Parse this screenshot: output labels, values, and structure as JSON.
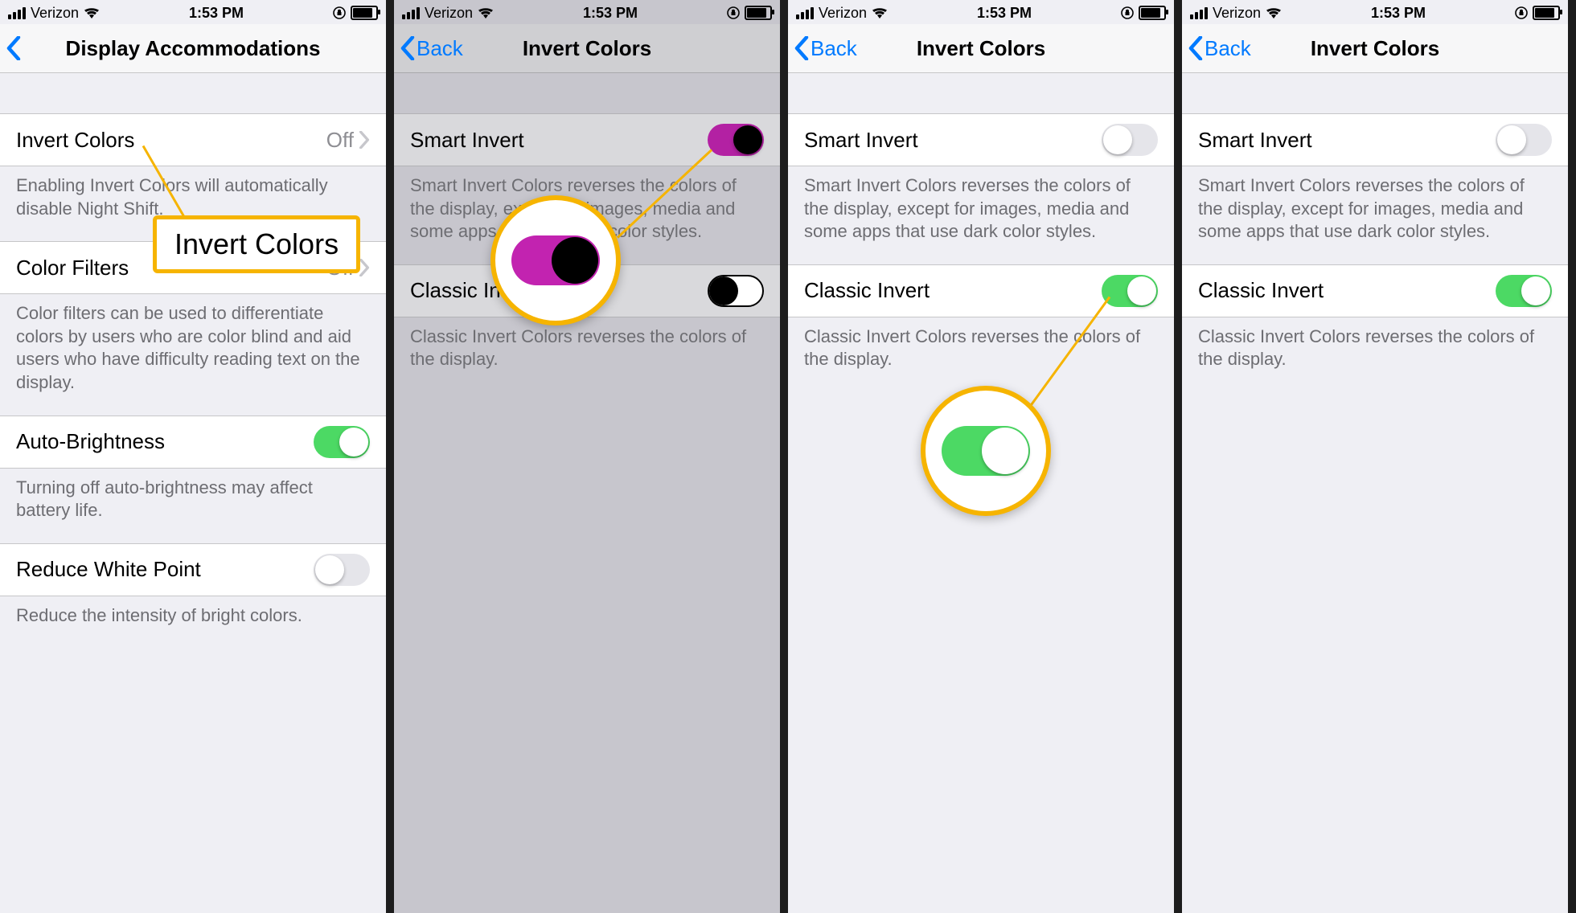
{
  "status": {
    "carrier": "Verizon",
    "time": "1:53 PM"
  },
  "screen1": {
    "nav_title": "Display Accommodations",
    "rows": {
      "invert": {
        "label": "Invert Colors",
        "value": "Off"
      },
      "filters": {
        "label": "Color Filters",
        "value": "Off"
      },
      "auto": {
        "label": "Auto-Brightness"
      },
      "rwp": {
        "label": "Reduce White Point"
      }
    },
    "foot": {
      "invert": "Enabling Invert Colors will automatically disable Night Shift.",
      "filters": "Color filters can be used to differentiate colors by users who are color blind and aid users who have difficulty reading text on the display.",
      "auto": "Turning off auto-brightness may affect battery life.",
      "rwp": "Reduce the intensity of bright colors."
    },
    "callout": "Invert Colors"
  },
  "screen2": {
    "back": "Back",
    "nav_title": "Invert Colors",
    "rows": {
      "smart": {
        "label": "Smart Invert"
      },
      "classic": {
        "label": "Classic Invert"
      }
    },
    "foot": {
      "smart": "Smart Invert Colors reverses the colors of the display, except for images, media and some apps that use dark color styles.",
      "classic": "Classic Invert Colors reverses the colors of the display."
    }
  },
  "screen3": {
    "back": "Back",
    "nav_title": "Invert Colors",
    "rows": {
      "smart": {
        "label": "Smart Invert"
      },
      "classic": {
        "label": "Classic Invert"
      }
    },
    "foot": {
      "smart": "Smart Invert Colors reverses the colors of the display, except for images, media and some apps that use dark color styles.",
      "classic": "Classic Invert Colors reverses the colors of the display."
    }
  }
}
